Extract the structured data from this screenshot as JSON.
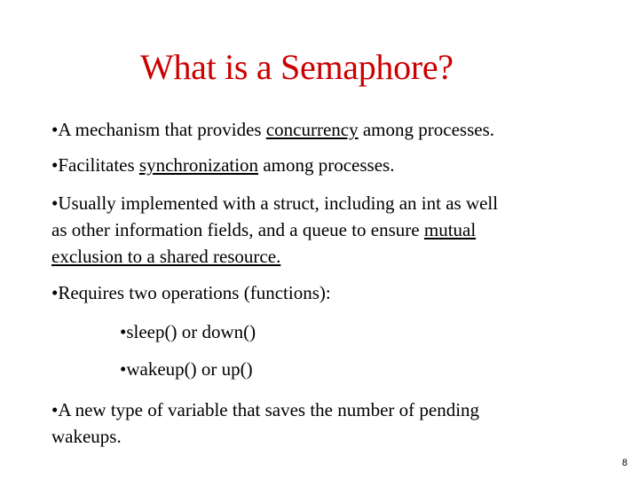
{
  "slide": {
    "title": "What is a Semaphore?",
    "bullet_char": "•",
    "bullets": [
      {
        "before": "A mechanism that provides ",
        "underlined": "concurrency",
        "after": " among processes."
      },
      {
        "before": "Facilitates ",
        "underlined": "synchronization",
        "after": " among processes."
      },
      {
        "line1": "Usually implemented with a struct, including an  int as well",
        "line2_before": "as other information fields,  and a queue to ensure ",
        "line2_underlined": "mutual",
        "line3_underlined": "exclusion to a shared resource."
      },
      {
        "text": "Requires two operations (functions):"
      },
      {
        "text": "A new type of variable that saves the number of pending",
        "line2": "wakeups."
      }
    ],
    "sub_bullets": [
      "sleep()  or down()",
      "wakeup() or up()"
    ],
    "page_number": "8"
  }
}
